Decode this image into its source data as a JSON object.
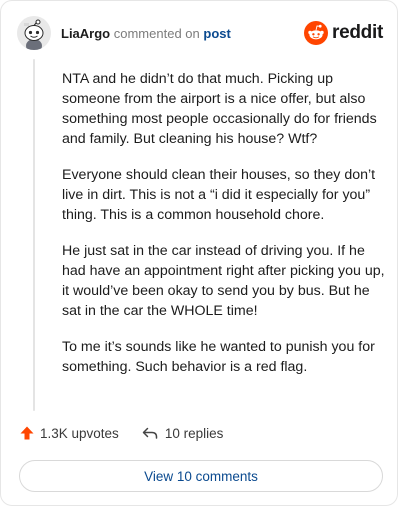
{
  "comment": {
    "username": "LiaArgo",
    "action_text": "commented on",
    "post_link_text": "post",
    "paragraphs": [
      "NTA and he didn’t do that much. Picking up someone from the airport is a nice offer, but also something most people occasionally do for friends and family. But cleaning his house? Wtf?",
      "Everyone should clean their houses, so they don’t live in dirt. This is not a “i did it especially for you” thing. This is a common household chore.",
      "He just sat in the car instead of driving you. If he had have an appointment right after picking you up, it would’ve been okay to send you by bus. But he sat in the car the WHOLE time!",
      "To me it’s sounds like he wanted to punish you for something. Such behavior is a red flag."
    ]
  },
  "logo": {
    "wordmark": "reddit",
    "icon": "reddit-alien-icon",
    "brand_color": "#ff4500"
  },
  "footer": {
    "upvotes_label": "1.3K upvotes",
    "upvote_icon": "upvote-arrow-icon",
    "upvote_color": "#ff4500",
    "replies_label": "10 replies",
    "reply_icon": "reply-arrow-icon"
  },
  "view_comments_label": "View 10 comments"
}
